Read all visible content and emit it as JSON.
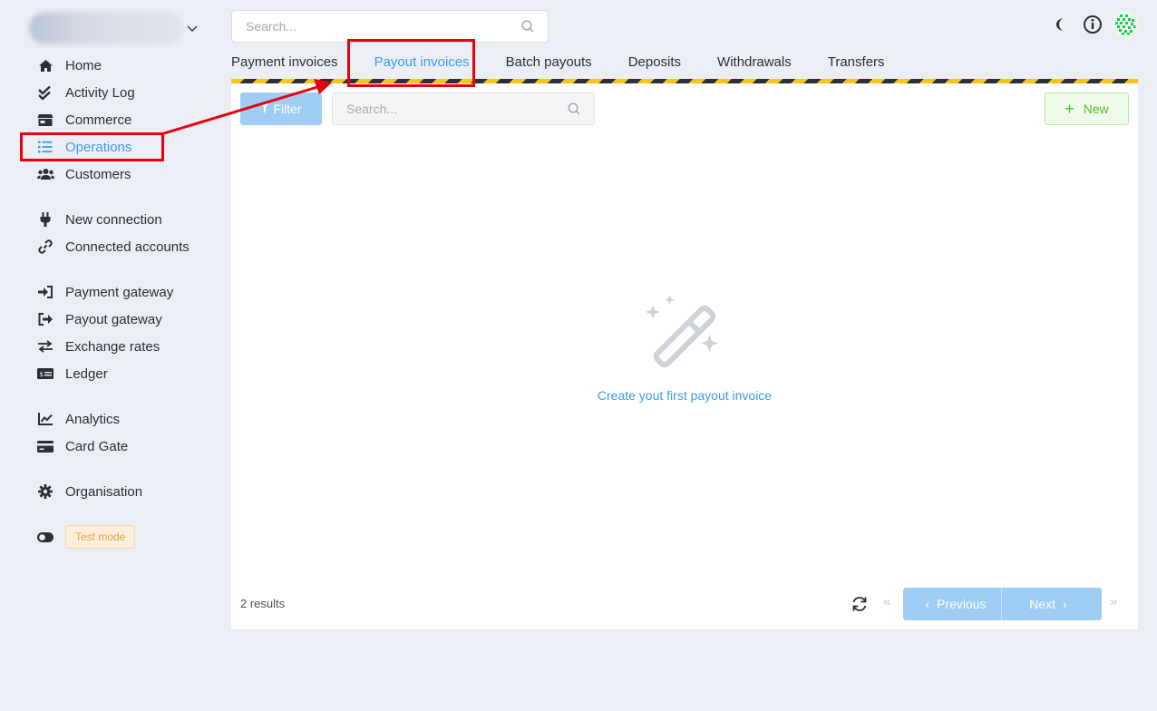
{
  "top_search": {
    "placeholder": "Search..."
  },
  "tabs": [
    {
      "label": "Payment invoices",
      "active": false
    },
    {
      "label": "Payout invoices",
      "active": true
    },
    {
      "label": "Batch payouts",
      "active": false
    },
    {
      "label": "Deposits",
      "active": false
    },
    {
      "label": "Withdrawals",
      "active": false
    },
    {
      "label": "Transfers",
      "active": false
    }
  ],
  "sidebar": {
    "items": [
      {
        "label": "Home",
        "icon": "home-icon"
      },
      {
        "label": "Activity Log",
        "icon": "double-check-icon"
      },
      {
        "label": "Commerce",
        "icon": "store-icon"
      },
      {
        "label": "Operations",
        "icon": "list-icon",
        "active": true
      },
      {
        "label": "Customers",
        "icon": "users-icon"
      },
      {
        "label": "New connection",
        "icon": "plug-icon"
      },
      {
        "label": "Connected accounts",
        "icon": "link-icon"
      },
      {
        "label": "Payment gateway",
        "icon": "sign-in-icon"
      },
      {
        "label": "Payout gateway",
        "icon": "sign-out-icon"
      },
      {
        "label": "Exchange rates",
        "icon": "exchange-icon"
      },
      {
        "label": "Ledger",
        "icon": "ledger-icon"
      },
      {
        "label": "Analytics",
        "icon": "chart-line-icon"
      },
      {
        "label": "Card Gate",
        "icon": "credit-card-icon"
      },
      {
        "label": "Organisation",
        "icon": "gear-icon"
      }
    ],
    "test_mode_label": "Test mode"
  },
  "toolbar": {
    "filter_label": "Filter",
    "search_placeholder": "Search...",
    "new_label": "New"
  },
  "empty_state": {
    "link_text": "Create yout first payout invoice"
  },
  "footer": {
    "results_text": "2 results",
    "previous_label": "Previous",
    "next_label": "Next"
  },
  "colors": {
    "accent": "#3d9be9",
    "new_button_text": "#5ab837",
    "test_mode_text": "#e0a349",
    "annotation_red": "#e8000b",
    "hazard_yellow": "#f5c518"
  }
}
